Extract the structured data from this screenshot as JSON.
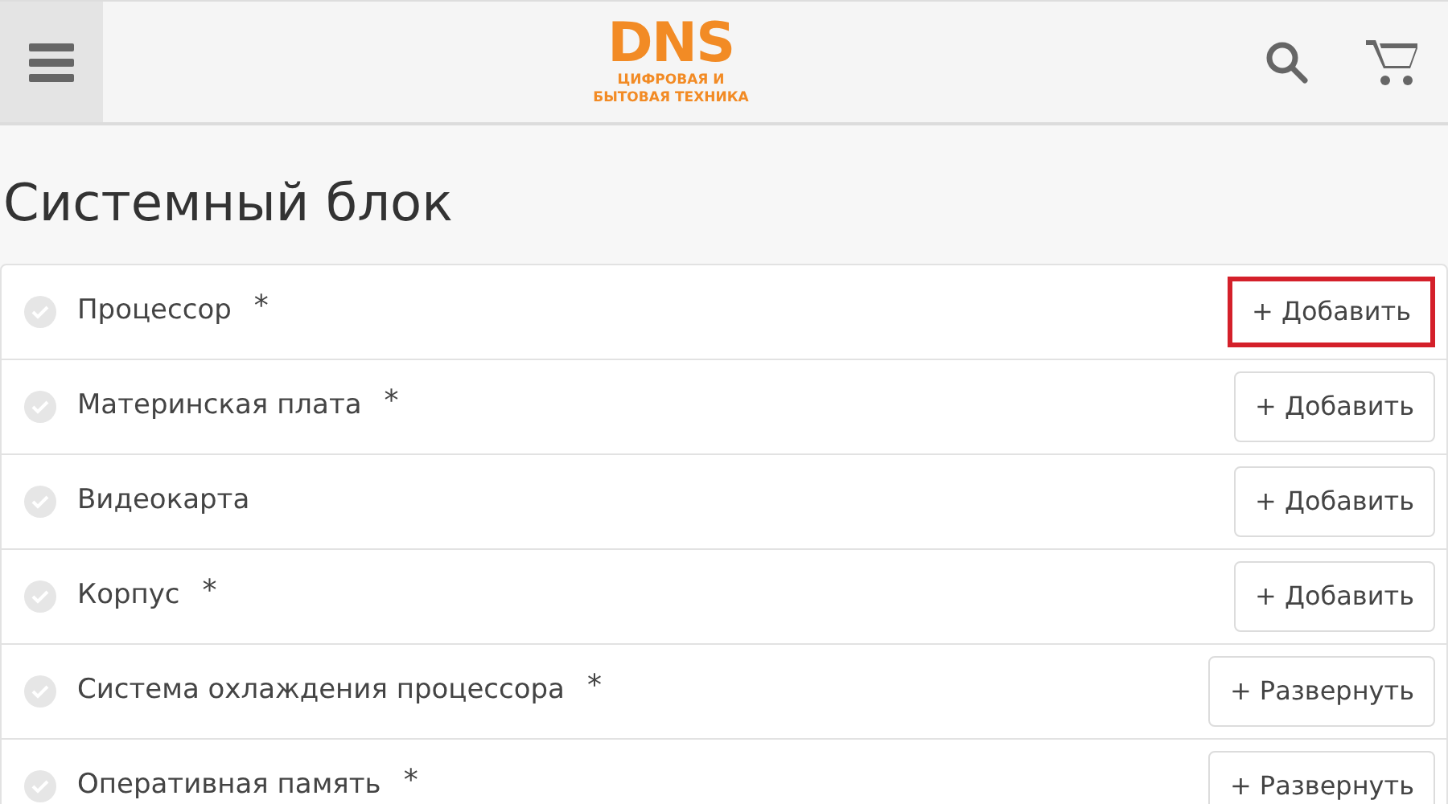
{
  "header": {
    "logo": {
      "brand": "DNS",
      "tagline_1": "ЦИФРОВАЯ И",
      "tagline_2": "БЫТОВАЯ ТЕХНИКА"
    }
  },
  "title": "Системный блок",
  "components": [
    {
      "name": "Процессор",
      "required": true,
      "action": "+ Добавить",
      "highlighted": true
    },
    {
      "name": "Материнская плата",
      "required": true,
      "action": "+ Добавить",
      "highlighted": false
    },
    {
      "name": "Видеокарта",
      "required": false,
      "action": "+ Добавить",
      "highlighted": false
    },
    {
      "name": "Корпус",
      "required": true,
      "action": "+ Добавить",
      "highlighted": false
    },
    {
      "name": "Система охлаждения процессора",
      "required": true,
      "action": "+ Развернуть",
      "highlighted": false
    },
    {
      "name": "Оперативная память",
      "required": true,
      "action": "+ Развернуть",
      "highlighted": false
    }
  ],
  "required_mark": "*"
}
